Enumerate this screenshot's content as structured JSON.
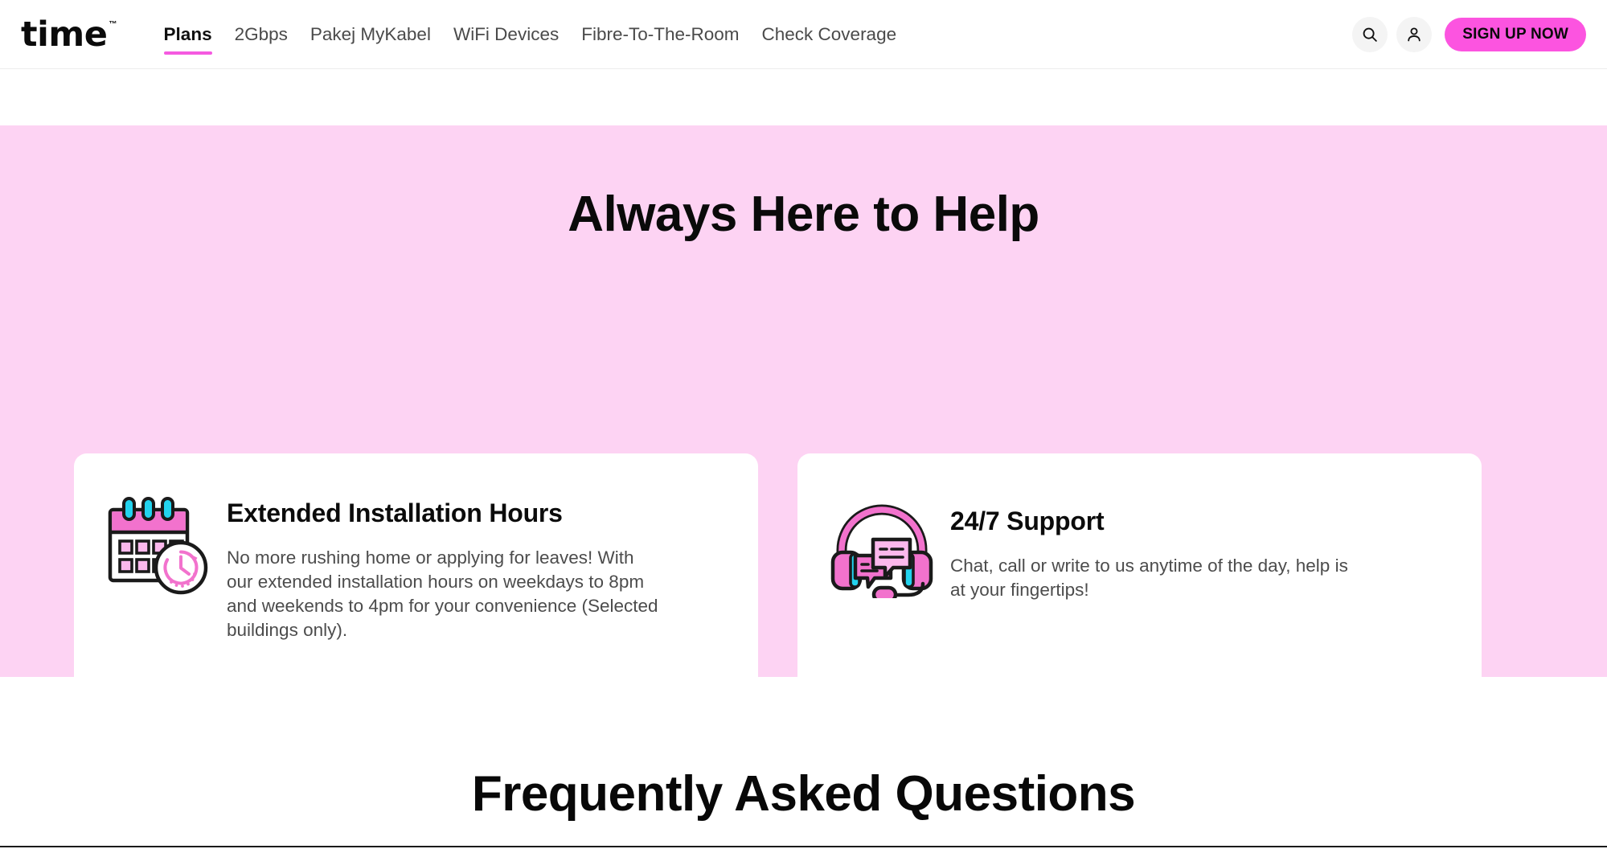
{
  "header": {
    "logo": {
      "text": "time",
      "tm": "™"
    },
    "nav": [
      {
        "label": "Plans",
        "active": true
      },
      {
        "label": "2Gbps",
        "active": false
      },
      {
        "label": "Pakej MyKabel",
        "active": false
      },
      {
        "label": "WiFi Devices",
        "active": false
      },
      {
        "label": "Fibre-To-The-Room",
        "active": false
      },
      {
        "label": "Check Coverage",
        "active": false
      }
    ],
    "search_icon": "search-icon",
    "account_icon": "person-icon",
    "signup_label": "SIGN UP NOW"
  },
  "help": {
    "title": "Always Here to Help",
    "background_color": "#fdd3f3",
    "cards": [
      {
        "icon": "calendar-clock-icon",
        "title": "Extended Installation Hours",
        "text": "No more rushing home or applying for leaves! With our extended installation hours on weekdays to 8pm and weekends to 4pm for your convenience (Selected buildings only)."
      },
      {
        "icon": "headset-chat-icon",
        "title": "24/7 Support",
        "text": "Chat, call or write to us anytime of the day, help is at your fingertips!"
      }
    ]
  },
  "faq": {
    "title": "Frequently Asked Questions"
  },
  "colors": {
    "accent_pink": "#fc54e0",
    "section_pink": "#fdd3f3",
    "icon_pink": "#f272cd",
    "icon_cyan": "#22d3ee",
    "text_dark": "#0b0b0b",
    "text_body": "#4c4c4c"
  }
}
